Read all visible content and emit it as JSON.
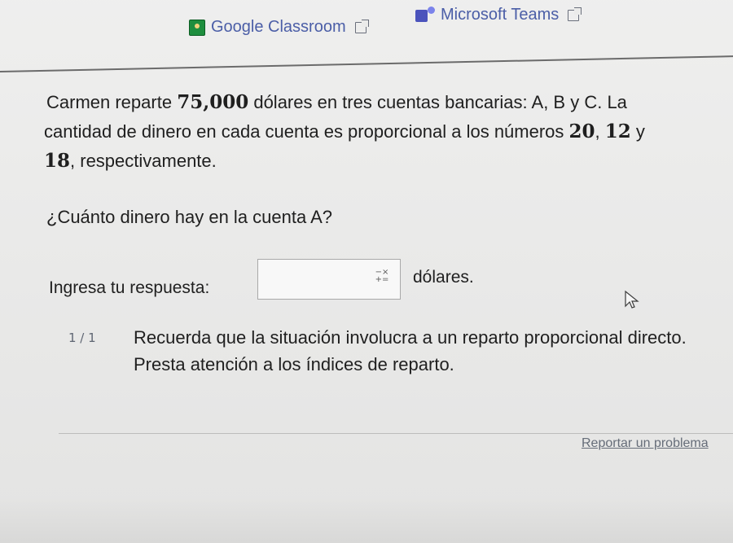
{
  "share_links": {
    "classroom_label": "Google Classroom",
    "teams_label": "Microsoft Teams"
  },
  "question": {
    "line1_prefix": "Carmen reparte ",
    "amount": "75,000",
    "line1_suffix": " dólares en tres cuentas bancarias: A, B y C. La",
    "line2_prefix": "cantidad de dinero en cada cuenta es proporcional a los números ",
    "num1": "20",
    "num_sep": ", ",
    "num2": "12",
    "line2_suffix": " y",
    "num3": "18",
    "line3_suffix": ", respectivamente."
  },
  "ask": "¿Cuánto dinero hay en la cuenta A?",
  "answer": {
    "label": "Ingresa tu respuesta:",
    "value": "",
    "unit": "dólares.",
    "math_toggle": "−×\n+="
  },
  "hint": {
    "counter": "1 / 1",
    "text": "Recuerda que la situación involucra a un reparto proporcional directo. Presta atención a los índices de reparto."
  },
  "footer": {
    "report_label": "Reportar un problema"
  },
  "colors": {
    "link": "#4b5ea7",
    "text": "#1f1f1f",
    "muted": "#666d79"
  },
  "icons": {
    "classroom": "google-classroom-icon",
    "teams": "microsoft-teams-icon",
    "external": "external-link-icon",
    "cursor": "mouse-cursor-icon"
  }
}
